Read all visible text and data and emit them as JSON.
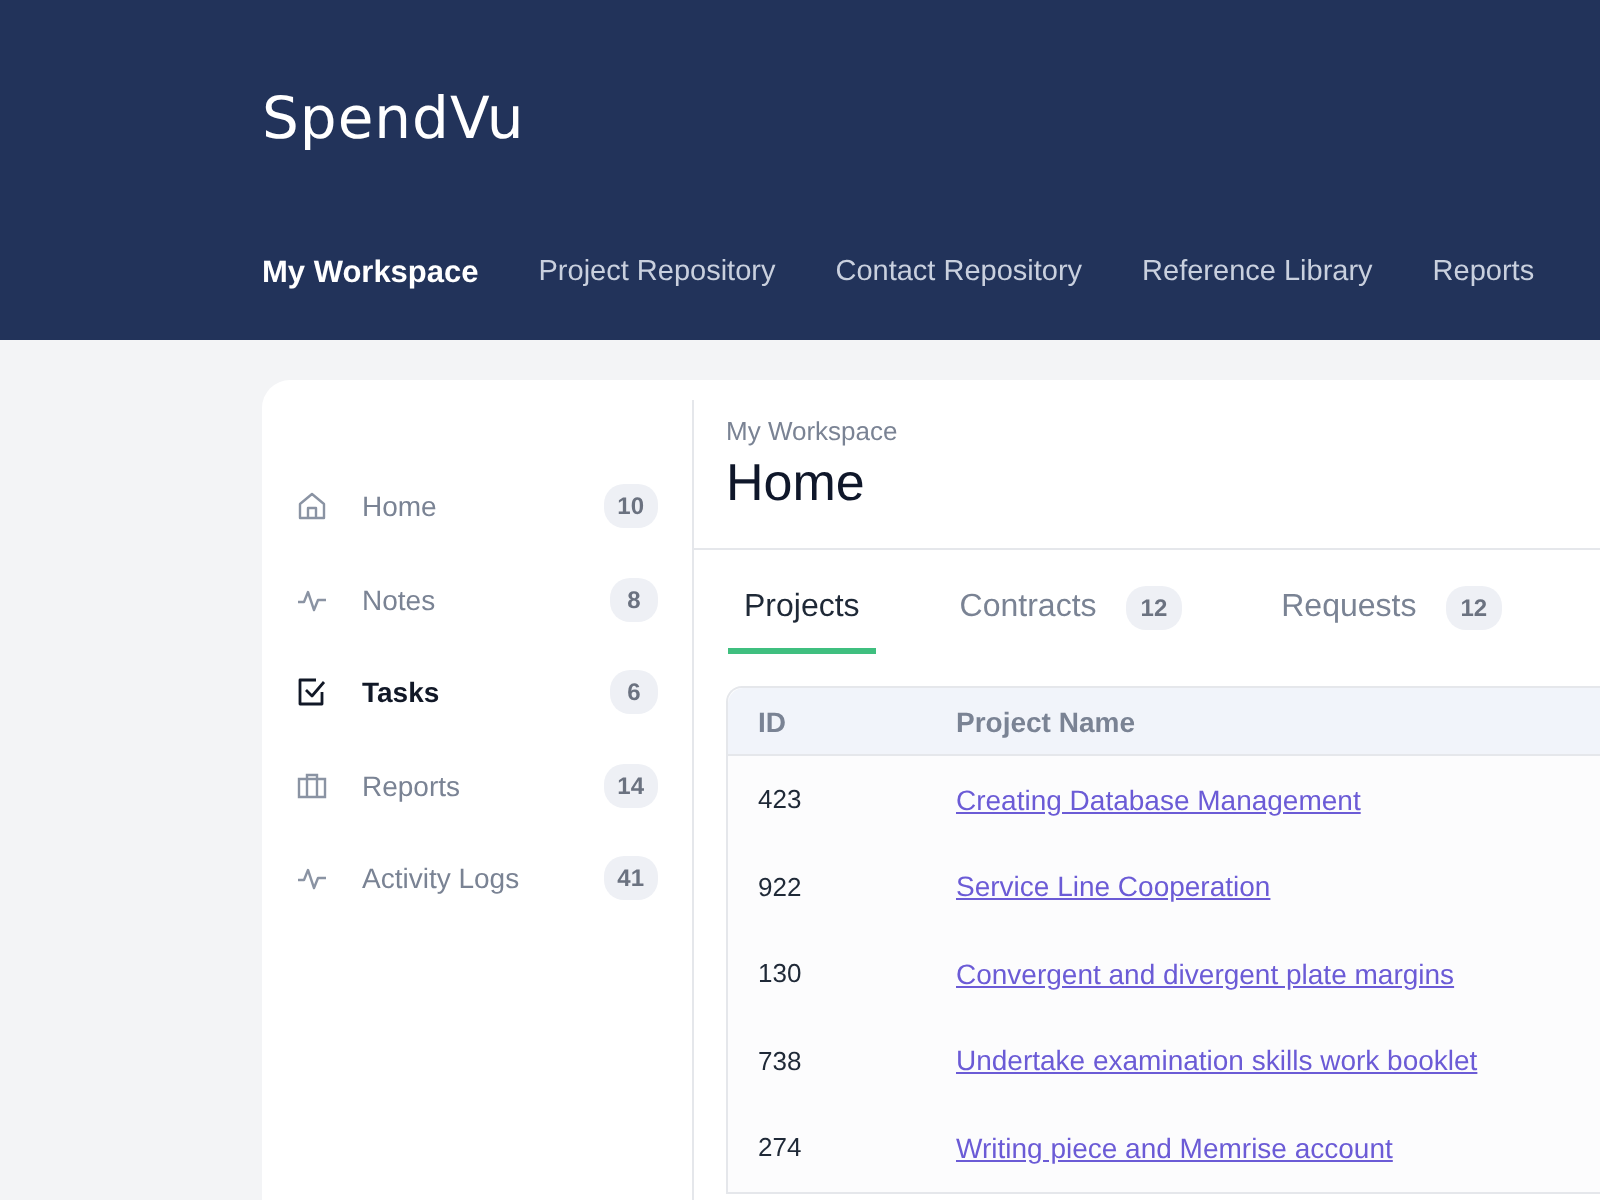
{
  "header": {
    "logo": "SpendVu",
    "nav": [
      {
        "label": "My Workspace",
        "selected": true
      },
      {
        "label": "Project Repository",
        "selected": false
      },
      {
        "label": "Contact Repository",
        "selected": false
      },
      {
        "label": "Reference Library",
        "selected": false
      },
      {
        "label": "Reports",
        "selected": false
      }
    ]
  },
  "sidebar": {
    "items": [
      {
        "kind": "home",
        "label": "Home",
        "count": "10",
        "selected": false
      },
      {
        "kind": "pulse",
        "label": "Notes",
        "count": "8",
        "selected": false
      },
      {
        "kind": "task",
        "label": "Tasks",
        "count": "6",
        "selected": true
      },
      {
        "kind": "briefcase",
        "label": "Reports",
        "count": "14",
        "selected": false
      },
      {
        "kind": "pulse",
        "label": "Activity Logs",
        "count": "41",
        "selected": false
      }
    ]
  },
  "main": {
    "breadcrumb": "My Workspace",
    "title": "Home",
    "tabs": [
      {
        "label": "Projects",
        "selected": true
      },
      {
        "label": "Contracts",
        "count": "12",
        "selected": false
      },
      {
        "label": "Requests",
        "count": "12",
        "selected": false
      }
    ],
    "table": {
      "columns": [
        "ID",
        "Project Name"
      ],
      "rows": [
        [
          "423",
          "Creating Database Management"
        ],
        [
          "922",
          "Service Line Cooperation"
        ],
        [
          "130",
          "Convergent and divergent plate margins"
        ],
        [
          "738",
          "Undertake examination skills work booklet"
        ],
        [
          "274",
          "Writing piece and Memrise account"
        ]
      ]
    }
  }
}
